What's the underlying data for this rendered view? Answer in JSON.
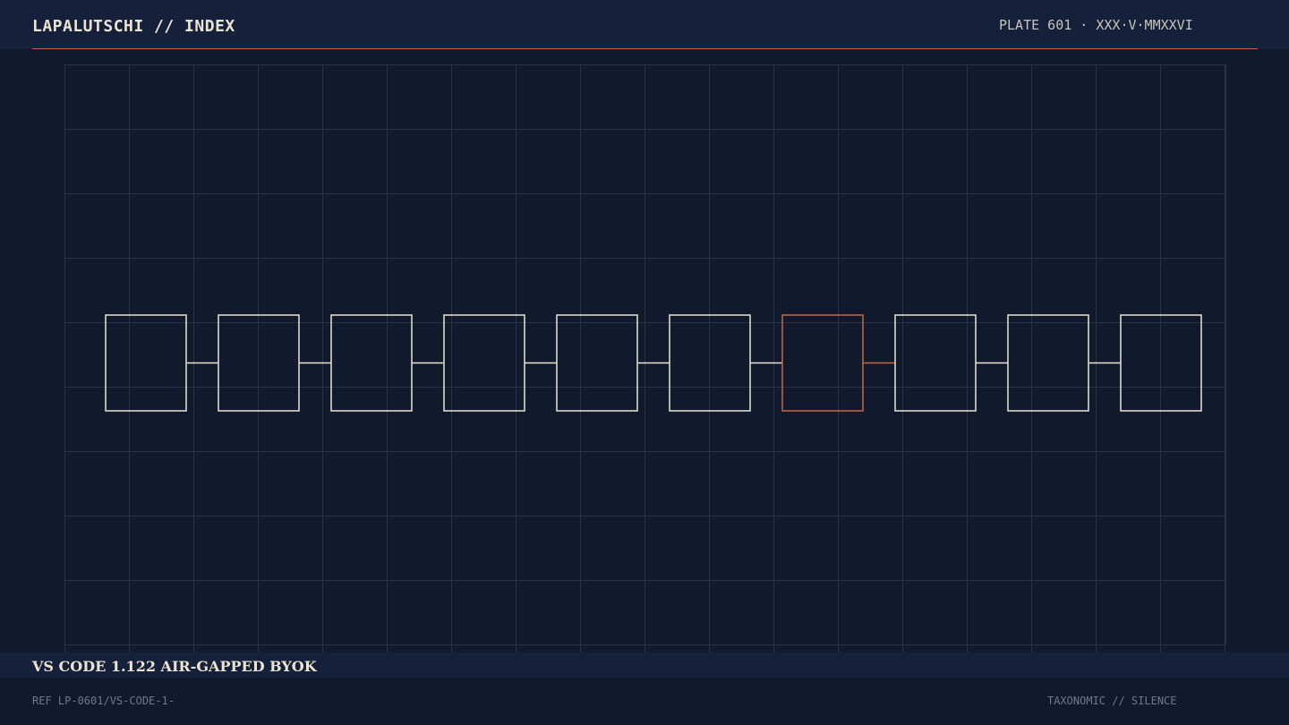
{
  "header": {
    "title": "LAPALUTSCHI // INDEX",
    "plate": "PLATE 601 · XXX·V·MMXXVI"
  },
  "diagram": {
    "node_count": 10,
    "highlighted_node": 7,
    "colors": {
      "background": "#111a2c",
      "grid": "#2a3448",
      "node": "#ece4d2",
      "accent": "#c8673e"
    }
  },
  "footer": {
    "caption": "VS CODE 1.122 AIR-GAPPED BYOK",
    "ref": "REF LP-0601/VS-CODE-1-",
    "tag": "TAXONOMIC // SILENCE"
  }
}
